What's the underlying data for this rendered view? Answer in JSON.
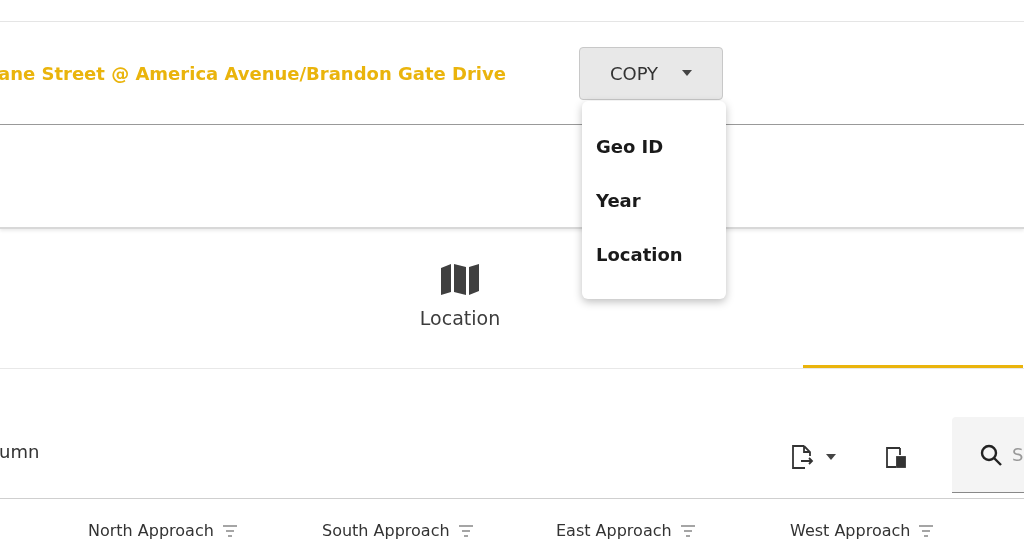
{
  "header": {
    "title": "ane Street @ America Avenue/Brandon Gate Drive",
    "copy_button": {
      "label": "COPY",
      "expanded": true
    }
  },
  "copy_menu": [
    "Geo ID",
    "Year",
    "Location"
  ],
  "tabs": [
    {
      "label": "Location",
      "selected": false
    },
    {
      "selected": true
    }
  ],
  "toolbar": {
    "text": "umn",
    "search": {
      "placeholder": "S"
    }
  },
  "table": {
    "columns": [
      "North Approach",
      "South Approach",
      "East Approach",
      "West Approach"
    ]
  }
}
